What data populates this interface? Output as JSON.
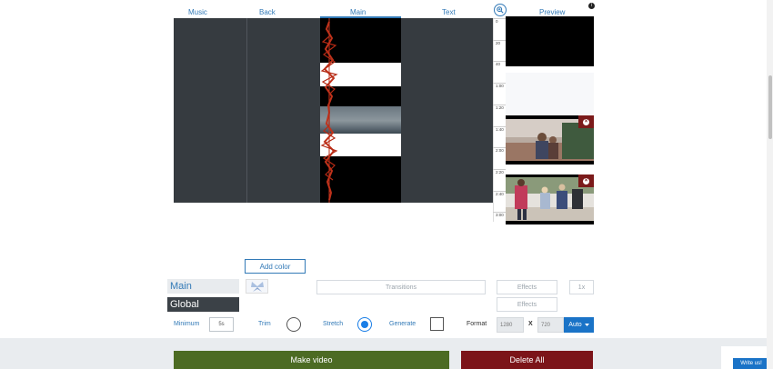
{
  "columns": {
    "music": "Music",
    "back": "Back",
    "main": "Main",
    "text": "Text",
    "preview": "Preview"
  },
  "ruler_ticks": [
    "0",
    "20",
    "40",
    "1:00",
    "1:20",
    "1:40",
    "2:00",
    "2:20",
    "2:40",
    "3:00"
  ],
  "controls": {
    "add_color": "Add color",
    "tab_main": "Main",
    "tab_global": "Global",
    "transitions_placeholder": "Transitions",
    "effects_1": "Effects",
    "effects_2": "Effects",
    "speed": "1x",
    "minimum_label": "Minimum",
    "minimum_value": "5s",
    "trim_label": "Trim",
    "stretch_label": "Stretch",
    "generate_label": "Generate",
    "format_label": "Format",
    "width_value": "1280",
    "x_sep": "X",
    "height_value": "720",
    "auto_label": "Auto"
  },
  "footer": {
    "make_video": "Make video",
    "delete_all": "Delete All",
    "write_us": "Write us!"
  },
  "colors": {
    "accent": "#337ab7",
    "make_video_bg": "#4c6b23",
    "delete_bg": "#7c1419",
    "waveform": "#c0321b"
  }
}
